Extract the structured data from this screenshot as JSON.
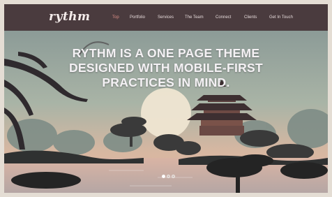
{
  "brand": {
    "logo_text": "rythm"
  },
  "nav": {
    "items": [
      {
        "label": "Top",
        "active": true
      },
      {
        "label": "Portfolio"
      },
      {
        "label": "Services"
      },
      {
        "label": "The Team"
      },
      {
        "label": "Connect"
      },
      {
        "label": "Clients"
      },
      {
        "label": "Get In Touch"
      }
    ]
  },
  "hero": {
    "headline_lines": [
      "RYTHM IS A ONE PAGE THEME",
      "DESIGNED WITH MOBILE-FIRST",
      "PRACTICES IN MIND."
    ],
    "slides_total": 3,
    "slide_active": 1
  },
  "colors": {
    "navbar_bg": "#4a3b3e",
    "nav_active": "#d98e86",
    "headline": "#f4f1f4"
  }
}
